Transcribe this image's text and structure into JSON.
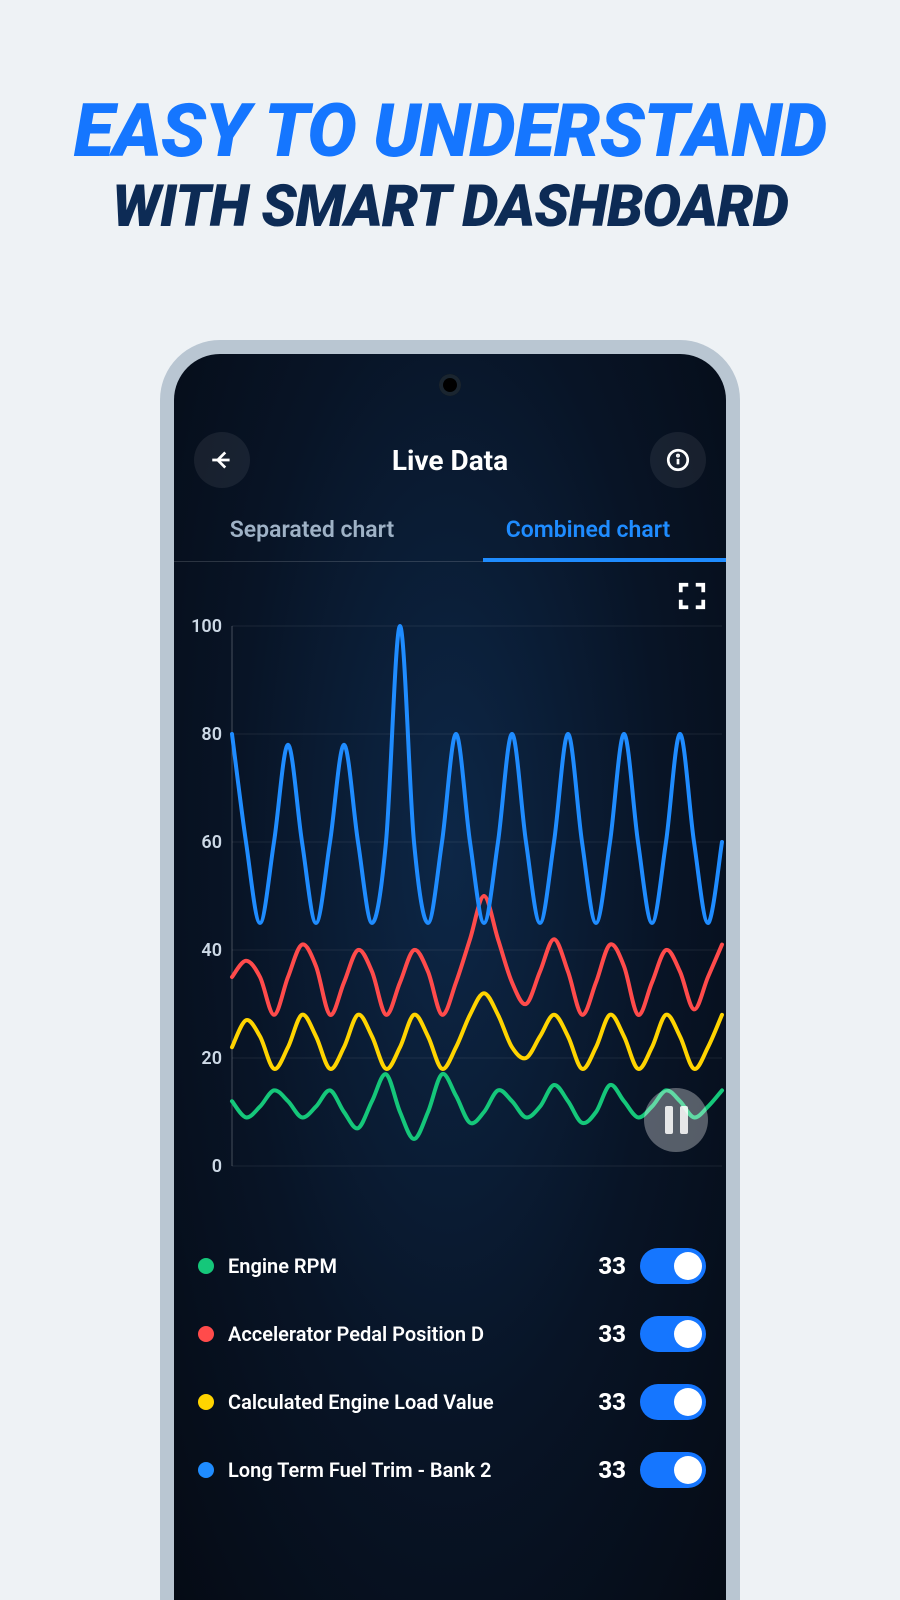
{
  "promo": {
    "line1": "EASY TO UNDERSTAND",
    "line2": "WITH SMART DASHBOARD"
  },
  "header": {
    "title": "Live Data"
  },
  "tabs": [
    {
      "label": "Separated chart",
      "active": false
    },
    {
      "label": "Combined chart",
      "active": true
    }
  ],
  "chart_data": {
    "type": "line",
    "ylabel": "",
    "ylim": [
      0,
      100
    ],
    "yticks": [
      0,
      20,
      40,
      60,
      80,
      100
    ],
    "x": [
      0,
      1,
      2,
      3,
      4,
      5,
      6,
      7,
      8,
      9,
      10,
      11,
      12,
      13,
      14,
      15,
      16,
      17,
      18,
      19,
      20,
      21,
      22,
      23,
      24,
      25,
      26,
      27,
      28,
      29,
      30,
      31,
      32,
      33,
      34,
      35
    ],
    "series": [
      {
        "name": "Engine RPM",
        "color": "#15c77a",
        "values": [
          12,
          9,
          11,
          14,
          12,
          9,
          11,
          14,
          10,
          7,
          12,
          17,
          10,
          5,
          10,
          17,
          13,
          8,
          10,
          14,
          12,
          9,
          11,
          15,
          12,
          8,
          10,
          15,
          12,
          9,
          11,
          14,
          12,
          9,
          11,
          14
        ]
      },
      {
        "name": "Accelerator Pedal Position D",
        "color": "#ff4b4b",
        "values": [
          35,
          38,
          35,
          28,
          35,
          41,
          37,
          28,
          34,
          40,
          36,
          28,
          34,
          40,
          36,
          28,
          34,
          42,
          50,
          42,
          34,
          30,
          36,
          42,
          36,
          28,
          34,
          41,
          37,
          28,
          34,
          40,
          36,
          29,
          35,
          41
        ]
      },
      {
        "name": "Calculated Engine Load Value",
        "color": "#ffd400",
        "values": [
          22,
          27,
          24,
          18,
          22,
          28,
          24,
          18,
          22,
          28,
          24,
          18,
          22,
          28,
          24,
          18,
          22,
          28,
          32,
          28,
          22,
          20,
          24,
          28,
          24,
          18,
          22,
          28,
          24,
          18,
          22,
          28,
          24,
          18,
          22,
          28
        ]
      },
      {
        "name": "Long Term Fuel Trim - Bank 2",
        "color": "#1f8cff",
        "values": [
          80,
          60,
          45,
          60,
          78,
          60,
          45,
          60,
          78,
          60,
          45,
          60,
          100,
          60,
          45,
          60,
          80,
          60,
          45,
          60,
          80,
          60,
          45,
          60,
          80,
          60,
          45,
          60,
          80,
          60,
          45,
          60,
          80,
          60,
          45,
          60
        ]
      }
    ]
  },
  "legend": [
    {
      "label": "Engine RPM",
      "value": "33",
      "color": "#15c77a"
    },
    {
      "label": "Accelerator Pedal Position D",
      "value": "33",
      "color": "#ff4b4b"
    },
    {
      "label": "Calculated Engine Load Value",
      "value": "33",
      "color": "#ffd400"
    },
    {
      "label": "Long Term Fuel Trim - Bank 2",
      "value": "33",
      "color": "#1f8cff"
    }
  ]
}
